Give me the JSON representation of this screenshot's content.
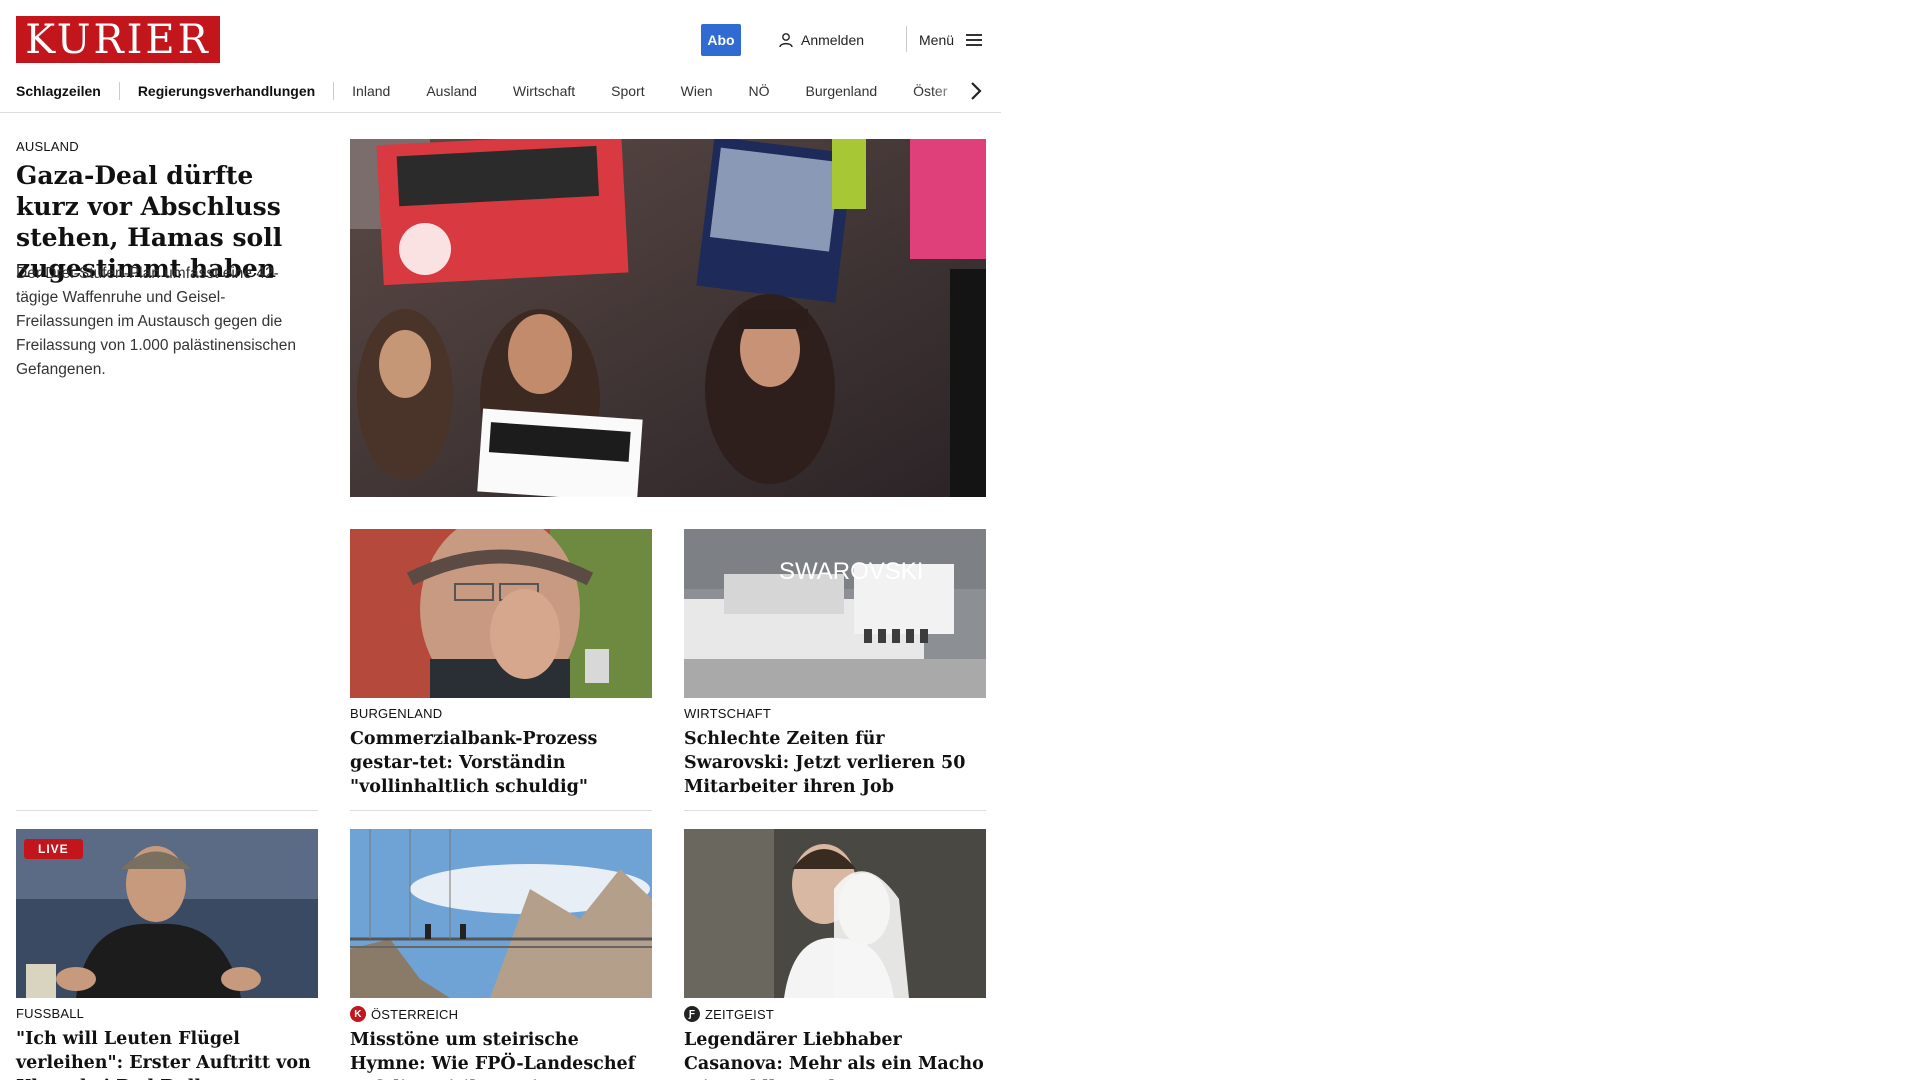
{
  "header": {
    "logo_text": "KURIER",
    "abo_label": "Abo",
    "login_label": "Anmelden",
    "menu_label": "Menü",
    "brand_color": "#c3161c",
    "abo_color": "#2f6bd0"
  },
  "nav": {
    "items": [
      "Schlagzeilen",
      "Regierungsverhandlungen",
      "Inland",
      "Ausland",
      "Wirtschaft",
      "Sport",
      "Wien",
      "NÖ",
      "Burgenland",
      "Öster"
    ]
  },
  "lead": {
    "kicker": "AUSLAND",
    "title": "Gaza-Deal dürfte kurz vor Abschluss stehen, Hamas soll zugestimmt haben",
    "teaser": "Der Drei-Stufen-Plan umfasst eine 42-tägige Waffenruhe und Geisel-Freilassungen im Austausch gegen die Freilassung von 1.000 palästinensischen Gefangenen."
  },
  "cards": [
    {
      "kicker": "BURGENLAND",
      "title": "Commerzialbank-Prozess gestar-tet: Vorständin \"vollinhaltlich schuldig\""
    },
    {
      "kicker": "WIRTSCHAFT",
      "title": "Schlechte Zeiten für Swarovski: Jetzt verlieren 50 Mitarbeiter ihren Job",
      "img_text": "SWAROVSKI"
    },
    {
      "kicker": "FUSSBALL",
      "title": "\"Ich will Leuten Flügel verleihen\": Erster Auftritt von Klopp bei Red Bull",
      "badge": "LIVE"
    },
    {
      "kicker": "ÖSTERREICH",
      "title": "Misstöne um steirische Hymne: Wie FPÖ-Landeschef auf die Kritik reagiert"
    },
    {
      "kicker": "ZEITGEIST",
      "title": "Legendärer Liebhaber Casanova: Mehr als ein Macho mit Goldketterl"
    }
  ]
}
